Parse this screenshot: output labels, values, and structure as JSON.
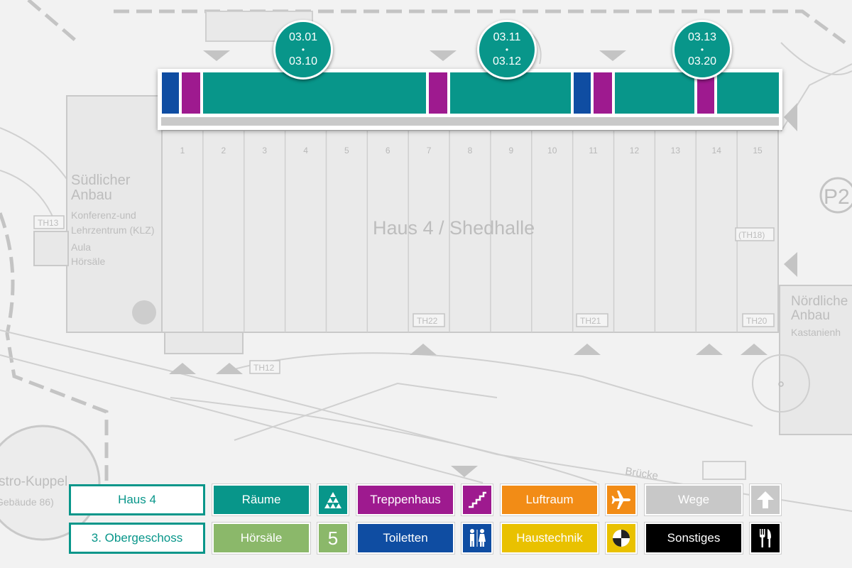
{
  "map": {
    "building_title": "Haus 4 / Shedhalle",
    "south_annex": {
      "name_line1": "Südlicher",
      "name_line2": "Anbau",
      "desc_line1": "Konferenz-und",
      "desc_line2": "Lehrzentrum (KLZ)",
      "desc_line3": "Aula",
      "desc_line4": "Hörsäle"
    },
    "north_annex": {
      "name_line1": "Nördliche",
      "name_line2": "Anbau",
      "desc_line1": "Kastanienh"
    },
    "dome": {
      "line1": "stro-Kuppel",
      "line2": "Gebäude 86)"
    },
    "parking": "P2",
    "bridge": "Brücke",
    "stairwells": {
      "th13": "TH13",
      "th12": "TH12",
      "th22": "TH22",
      "th21": "TH21",
      "th20": "TH20",
      "th18": "(TH18)"
    },
    "bay_numbers": [
      "1",
      "2",
      "3",
      "4",
      "5",
      "6",
      "7",
      "8",
      "9",
      "10",
      "11",
      "12",
      "13",
      "14",
      "15"
    ]
  },
  "room_badges": [
    {
      "from": "03.01",
      "sep": "•",
      "to": "03.10"
    },
    {
      "from": "03.11",
      "sep": "•",
      "to": "03.12"
    },
    {
      "from": "03.13",
      "sep": "•",
      "to": "03.20"
    }
  ],
  "colors": {
    "rooms": "#08968a",
    "stairwell": "#9e1a8f",
    "toilets": "#0f4da2",
    "lecture_halls": "#8bb86a",
    "airspace": "#f28c16",
    "utilities": "#e9c100",
    "paths": "#c8c8c8",
    "other": "#000000"
  },
  "legend": {
    "building": "Haus 4",
    "floor": "3. Obergeschoss",
    "rooms": "Räume",
    "lecture_halls": "Hörsäle",
    "lecture_halls_icon_text": "5",
    "stairwell": "Treppenhaus",
    "toilets": "Toiletten",
    "airspace": "Luftraum",
    "utilities": "Haustechnik",
    "paths": "Wege",
    "other": "Sonstiges"
  },
  "icons": {
    "rooms": "triangle-grid-icon",
    "stairs": "stairs-icon",
    "toilets": "restroom-icon",
    "airspace": "airplane-icon",
    "utilities": "utility-disc-icon",
    "paths": "arrow-up-icon",
    "other": "fork-knife-icon"
  }
}
